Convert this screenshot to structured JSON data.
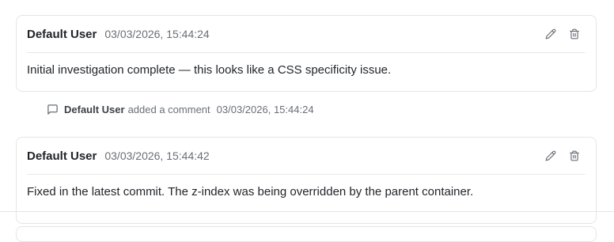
{
  "comments": [
    {
      "author": "Default User",
      "timestamp": "03/03/2026, 15:44:24",
      "body": "Initial investigation complete — this looks like a CSS specificity issue.",
      "edit_icon": "pencil-icon",
      "delete_icon": "trash-icon"
    },
    {
      "author": "Default User",
      "timestamp": "03/03/2026, 15:44:42",
      "body": "Fixed in the latest commit. The z-index was being overridden by the parent container.",
      "edit_icon": "pencil-icon",
      "delete_icon": "trash-icon"
    }
  ],
  "activity": {
    "icon": "message-square-icon",
    "author": "Default User",
    "action": "added a comment",
    "timestamp": "03/03/2026, 15:44:24"
  },
  "colors": {
    "border": "#e3e5e8",
    "text": "#1f2328",
    "muted": "#6a6f76"
  }
}
